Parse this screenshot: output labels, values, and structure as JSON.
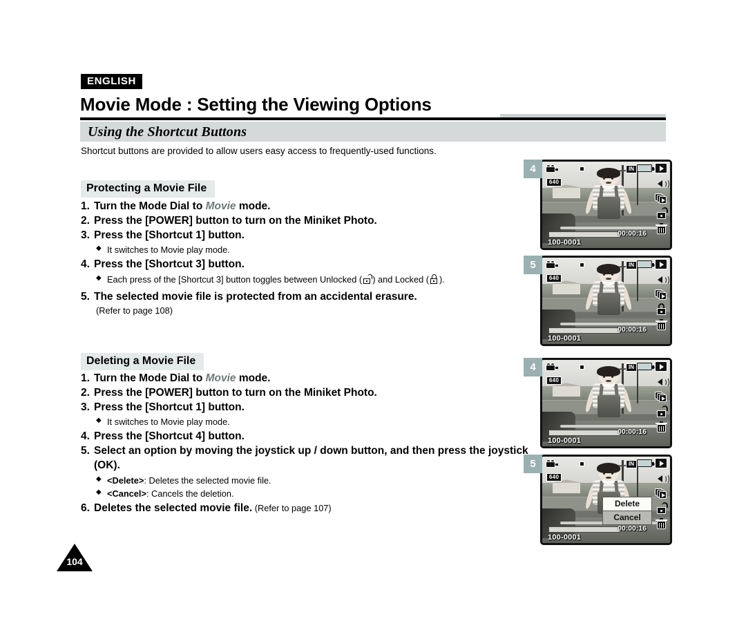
{
  "header": {
    "language_badge": "ENGLISH",
    "title": "Movie Mode : Setting the Viewing Options",
    "subtitle": "Using the Shortcut Buttons"
  },
  "intro": "Shortcut buttons are provided to allow users easy access to frequently-used functions.",
  "section1": {
    "heading": "Protecting a Movie File",
    "steps": [
      {
        "num": "1.",
        "pre": "Turn the Mode Dial to ",
        "ital": "Movie",
        "post": " mode."
      },
      {
        "num": "2.",
        "pre": "Press the [POWER] button to turn on the Miniket Photo.",
        "ital": "",
        "post": ""
      },
      {
        "num": "3.",
        "pre": "Press the [Shortcut 1] button.",
        "ital": "",
        "post": ""
      },
      {
        "num": "4.",
        "pre": "Press the [Shortcut 3] button.",
        "ital": "",
        "post": ""
      },
      {
        "num": "5.",
        "pre": "The selected movie file is protected from an accidental erasure.",
        "ital": "",
        "post": ""
      }
    ],
    "bullet_step3": "It switches to Movie play mode.",
    "bullet_step4_pre": "Each press of the [Shortcut 3] button toggles between Unlocked (",
    "bullet_step4_mid": ") and Locked (",
    "bullet_step4_post": ").",
    "refer": "(Refer to page 108)"
  },
  "section2": {
    "heading": "Deleting a Movie File",
    "steps": [
      {
        "num": "1.",
        "pre": "Turn the Mode Dial to ",
        "ital": "Movie",
        "post": "  mode."
      },
      {
        "num": "2.",
        "pre": "Press the [POWER] button to turn on the Miniket Photo.",
        "ital": "",
        "post": ""
      },
      {
        "num": "3.",
        "pre": "Press the [Shortcut 1] button.",
        "ital": "",
        "post": ""
      },
      {
        "num": "4.",
        "pre": "Press the [Shortcut 4] button.",
        "ital": "",
        "post": ""
      },
      {
        "num": "5.",
        "pre": "Select an option by moving the joystick up / down button, and then press the joystick (OK).",
        "ital": "",
        "post": ""
      }
    ],
    "bullet_step3": "It switches to Movie play mode.",
    "bullet_delete_label": "<Delete>",
    "bullet_delete_text": ": Deletes the selected movie file.",
    "bullet_cancel_label": "<Cancel>",
    "bullet_cancel_text": ": Cancels the deletion.",
    "step6_num": "6.",
    "step6_bold": "Deletes the selected movie file.",
    "step6_norm": " (Refer to page 107)"
  },
  "lcd_panels": [
    {
      "tab": "4",
      "resolution": "640",
      "memory": "IN",
      "file_number": "100-0001",
      "timecode": "00:00:16",
      "lock_state": "unlocked",
      "dialog": null
    },
    {
      "tab": "5",
      "resolution": "640",
      "memory": "IN",
      "file_number": "100-0001",
      "timecode": "00:00:16",
      "lock_state": "locked",
      "dialog": null
    },
    {
      "tab": "4",
      "resolution": "640",
      "memory": "IN",
      "file_number": "100-0001",
      "timecode": "00:00:16",
      "lock_state": "unlocked",
      "dialog": null
    },
    {
      "tab": "5",
      "resolution": "640",
      "memory": "IN",
      "file_number": "100-0001",
      "timecode": "00:00:16",
      "lock_state": "unlocked",
      "dialog": {
        "selected": "Delete",
        "option": "Cancel"
      }
    }
  ],
  "page_number": "104",
  "colors": {
    "subtitle_bar": "#d4dada",
    "section_heading_bg": "#e4e9e9",
    "tab_bg": "#9bb0b0",
    "italic_movie": "#6d7a7a"
  }
}
